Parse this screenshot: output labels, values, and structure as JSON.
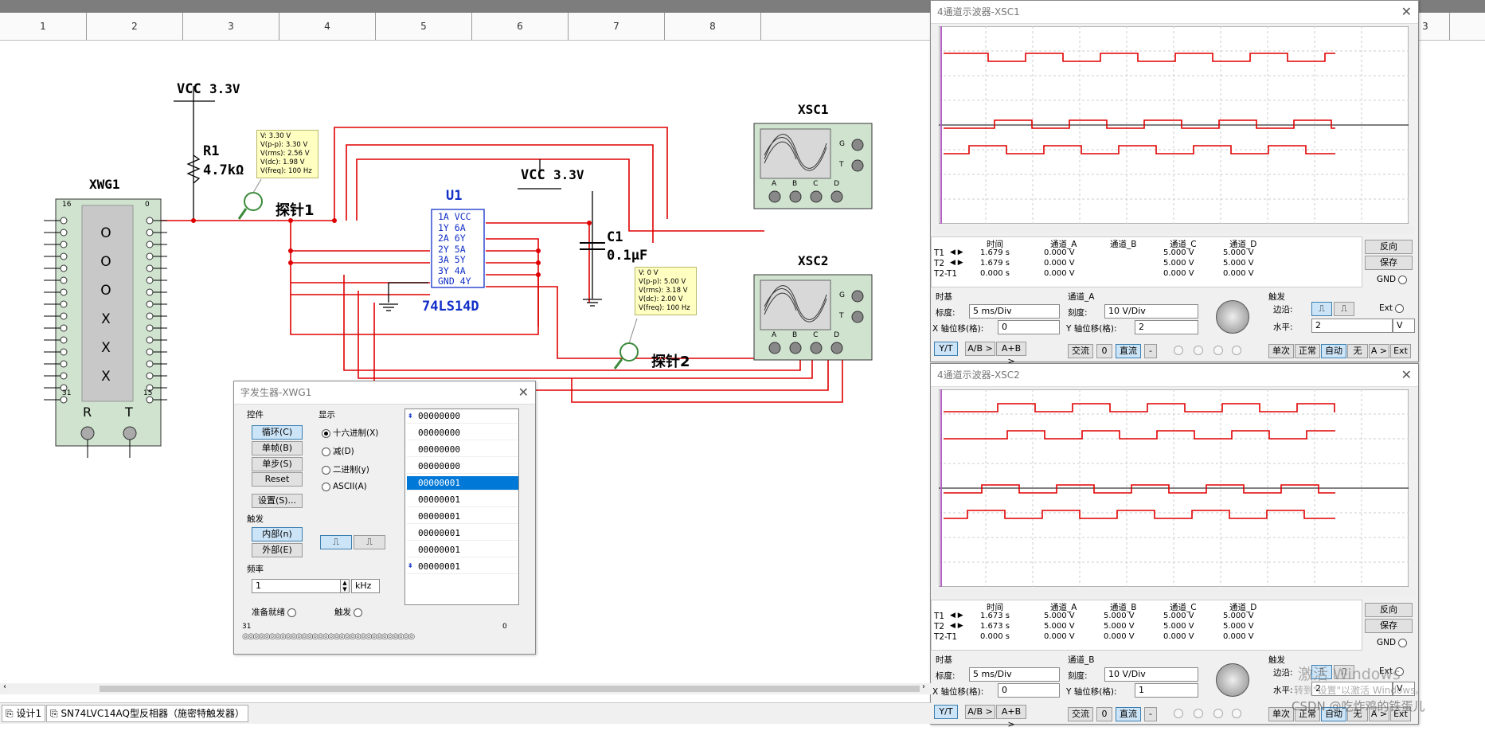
{
  "ruler": [
    "1",
    "2",
    "3",
    "4",
    "5",
    "6",
    "7",
    "8",
    "3"
  ],
  "tabs": {
    "design": "设计1",
    "document": "SN74LVC14AQ型反相器（施密特触发器）"
  },
  "circuit": {
    "vcc1": "VCC",
    "vcc1_val": "3.3V",
    "vcc2": "VCC",
    "vcc2_val": "3.3V",
    "r1": "R1",
    "r1_val": "4.7kΩ",
    "xwg1": "XWG1",
    "xwg_top_left": "16",
    "xwg_top_right": "0",
    "xwg_bot_left": "31",
    "xwg_bot_right": "15",
    "xwg_symbols": [
      "O",
      "O",
      "O",
      "X",
      "X",
      "X"
    ],
    "xwg_r": "R",
    "xwg_t": "T",
    "probe1_label": "探针1",
    "probe2_label": "探针2",
    "probe1_readings": [
      "V: 3.30 V",
      "V(p-p): 3.30 V",
      "V(rms): 2.56 V",
      "V(dc): 1.98 V",
      "V(freq): 100 Hz"
    ],
    "probe2_readings": [
      "V: 0 V",
      "V(p-p): 5.00 V",
      "V(rms): 3.18 V",
      "V(dc): 2.00 V",
      "V(freq): 100 Hz"
    ],
    "u1": "U1",
    "u1_part": "74LS14D",
    "u1_pins": [
      "1A VCC",
      "1Y  6A",
      "2A  6Y",
      "2Y  5A",
      "3A  5Y",
      "3Y  4A",
      "GND 4Y"
    ],
    "c1": "C1",
    "c1_val": "0.1µF",
    "xsc1": "XSC1",
    "xsc2": "XSC2",
    "scope_ch": [
      "A",
      "B",
      "C",
      "D"
    ],
    "scope_g": "G",
    "scope_t": "T"
  },
  "wordgen": {
    "title": "字发生器-XWG1",
    "controls_label": "控件",
    "btn_cycle": "循环(C)",
    "btn_burst": "单帧(B)",
    "btn_step": "单步(S)",
    "btn_reset": "Reset",
    "btn_settings": "设置(S)...",
    "display_label": "显示",
    "display_opts": [
      "十六进制(X)",
      "减(D)",
      "二进制(y)",
      "ASCII(A)"
    ],
    "trigger_label": "触发",
    "btn_internal": "内部(n)",
    "btn_external": "外部(E)",
    "freq_label": "频率",
    "freq_value": "1",
    "freq_unit": "kHz",
    "ready_label": "准备就绪",
    "trig_label": "触发",
    "bit_left": "31",
    "bit_right": "0",
    "rows": [
      "00000000",
      "00000000",
      "00000000",
      "00000000",
      "00000001",
      "00000001",
      "00000001",
      "00000001",
      "00000001",
      "00000001"
    ],
    "selected_row": 4
  },
  "scope1": {
    "title": "4通道示波器-XSC1",
    "headers": [
      "时间",
      "通道_A",
      "通道_B",
      "通道_C",
      "通道_D"
    ],
    "rows": [
      {
        "label": "T1",
        "time": "1.679 s",
        "a": "0.000 V",
        "b": "",
        "c": "5.000 V",
        "d": "5.000 V"
      },
      {
        "label": "T2",
        "time": "1.679 s",
        "a": "0.000 V",
        "b": "",
        "c": "5.000 V",
        "d": "5.000 V"
      },
      {
        "label": "T2-T1",
        "time": "0.000 s",
        "a": "0.000 V",
        "b": "",
        "c": "0.000 V",
        "d": "0.000 V"
      }
    ],
    "btn_reverse": "反向",
    "btn_save": "保存",
    "gnd": "GND",
    "timebase_label": "时基",
    "scale_label": "标度:",
    "scale_value": "5 ms/Div",
    "xpos_label": "X 轴位移(格):",
    "xpos_value": "0",
    "channel_label": "通道_A",
    "ch_scale_label": "刻度:",
    "ch_scale_value": "10  V/Div",
    "ypos_label": "Y 轴位移(格):",
    "ypos_value": "2",
    "trigger_label": "触发",
    "edge_label": "边沿:",
    "level_label": "水平:",
    "level_value": "2",
    "level_unit": "V",
    "ext": "Ext",
    "mode_btns": [
      "Y/T",
      "A/B >",
      "A+B >"
    ],
    "coupling_btns": [
      "交流",
      "0",
      "直流",
      "-"
    ],
    "trig_btns": [
      "单次",
      "正常",
      "自动",
      "无",
      "A >",
      "Ext"
    ]
  },
  "scope2": {
    "title": "4通道示波器-XSC2",
    "headers": [
      "时间",
      "通道_A",
      "通道_B",
      "通道_C",
      "通道_D"
    ],
    "rows": [
      {
        "label": "T1",
        "time": "1.673 s",
        "a": "5.000 V",
        "b": "5.000 V",
        "c": "5.000 V",
        "d": "5.000 V"
      },
      {
        "label": "T2",
        "time": "1.673 s",
        "a": "5.000 V",
        "b": "5.000 V",
        "c": "5.000 V",
        "d": "5.000 V"
      },
      {
        "label": "T2-T1",
        "time": "0.000 s",
        "a": "0.000 V",
        "b": "0.000 V",
        "c": "0.000 V",
        "d": "0.000 V"
      }
    ],
    "btn_reverse": "反向",
    "btn_save": "保存",
    "gnd": "GND",
    "timebase_label": "时基",
    "scale_label": "标度:",
    "scale_value": "5 ms/Div",
    "xpos_label": "X 轴位移(格):",
    "xpos_value": "0",
    "channel_label": "通道_B",
    "ch_scale_label": "刻度:",
    "ch_scale_value": "10  V/Div",
    "ypos_label": "Y 轴位移(格):",
    "ypos_value": "1",
    "trigger_label": "触发",
    "edge_label": "边沿:",
    "level_label": "水平:",
    "level_value": "2",
    "level_unit": "V",
    "ext": "Ext",
    "mode_btns": [
      "Y/T",
      "A/B >",
      "A+B >"
    ],
    "coupling_btns": [
      "交流",
      "0",
      "直流",
      "-"
    ],
    "trig_btns": [
      "单次",
      "正常",
      "自动",
      "无",
      "A >",
      "Ext"
    ]
  },
  "watermark": {
    "line1": "激活 Windows",
    "line2": "转到\"设置\"以激活 Windows。",
    "line3": "CSDN @吃炸鸡的铁蛋儿"
  },
  "colors": {
    "wire": "#e00000",
    "chip_text": "#1230c8",
    "trace": "#e00000",
    "instrument": "#cfe3cf"
  }
}
